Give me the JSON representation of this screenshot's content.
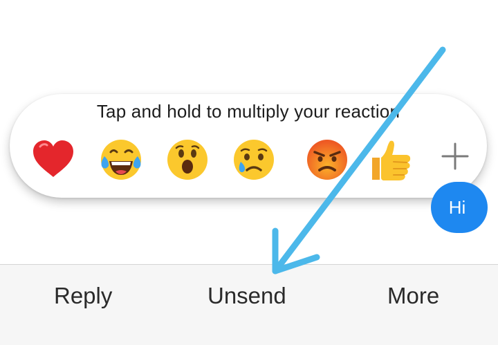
{
  "reaction_picker": {
    "hint": "Tap and hold to multiply your reaction",
    "reactions": [
      {
        "icon": "red-heart"
      },
      {
        "icon": "face-with-tears-of-joy"
      },
      {
        "icon": "face-with-open-mouth"
      },
      {
        "icon": "crying-face"
      },
      {
        "icon": "angry-face"
      },
      {
        "icon": "thumbs-up"
      }
    ],
    "more_icon": "plus-icon"
  },
  "message": {
    "text": "Hi",
    "color": "#1e88f0"
  },
  "actions": {
    "reply": "Reply",
    "unsend": "Unsend",
    "more": "More"
  },
  "annotation": {
    "arrow_color": "#4cb8ea"
  }
}
